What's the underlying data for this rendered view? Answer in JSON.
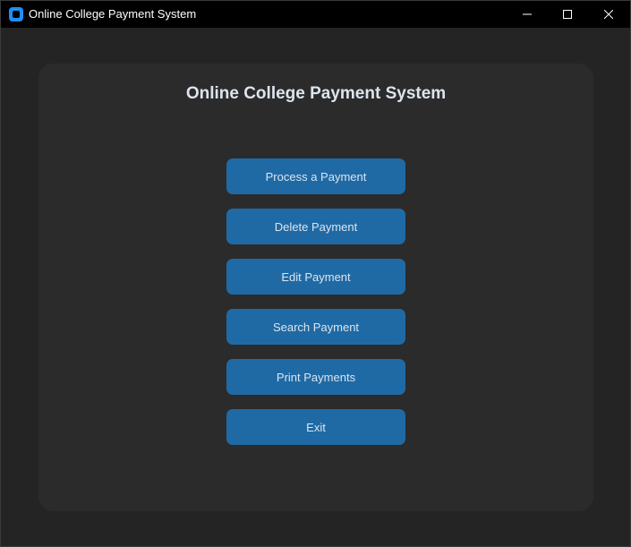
{
  "window": {
    "title": "Online College Payment System",
    "icon": "app-icon",
    "controls": [
      "minimize-icon",
      "maximize-icon",
      "close-icon"
    ]
  },
  "main": {
    "heading": "Online College Payment System",
    "buttons": [
      {
        "label": "Process a Payment"
      },
      {
        "label": "Delete Payment"
      },
      {
        "label": "Edit Payment"
      },
      {
        "label": "Search Payment"
      },
      {
        "label": "Print Payments"
      },
      {
        "label": "Exit"
      }
    ]
  },
  "colors": {
    "background": "#242424",
    "panel": "#2b2b2b",
    "button": "#1f6aa5",
    "text": "#dce4ee",
    "titlebar": "#000000"
  }
}
